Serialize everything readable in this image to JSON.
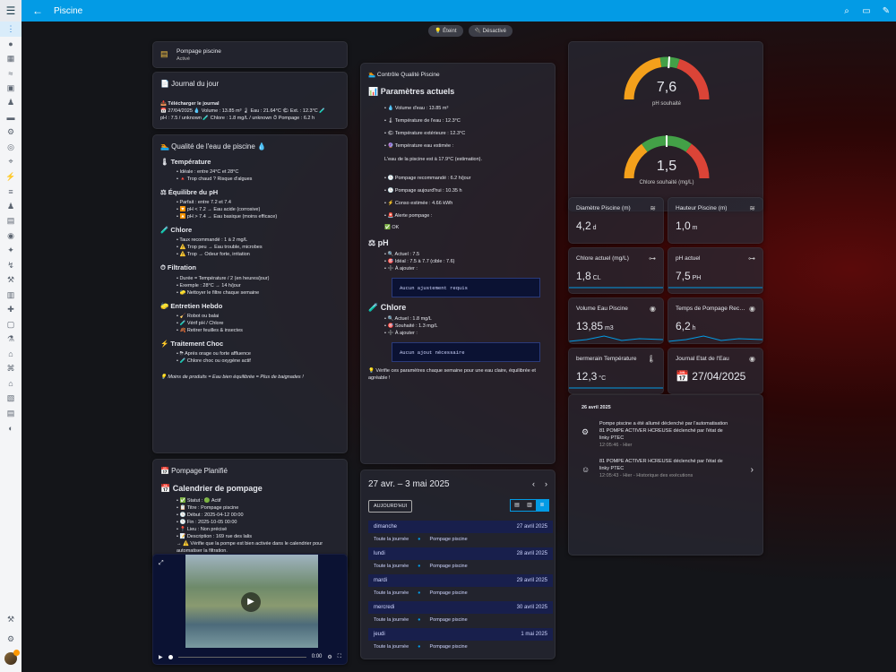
{
  "header": {
    "title": "Piscine",
    "menu_icon": "menu-icon",
    "back_icon": "arrow-left-icon",
    "actions": [
      "search-icon",
      "chat-icon",
      "pencil-icon"
    ]
  },
  "chips": [
    {
      "icon": "💡",
      "label": "Éteint"
    },
    {
      "icon": "🔌",
      "label": "Désactivé"
    }
  ],
  "pump": {
    "title": "Pompage piscine",
    "status": "Activé"
  },
  "journal": {
    "title": "📄 Journal du jour",
    "download": "📥 Télécharger le journal",
    "line1": "📅 27/04/2025 💧 Volume : 13.85 m³ 🌡 Eau : 21.64°C 🌤 Ext. : 12.3°C 🧪",
    "line2": "pH : 7.5 / unknown 🧪 Chlore : 1.8 mg/L / unknown ⏱ Pompage : 6.2 h"
  },
  "quality": {
    "title": "🏊 Qualité de l'eau de piscine 💧",
    "sections": [
      {
        "title": "🌡 Température",
        "items": [
          "• Idéale : entre 24°C et 28°C",
          "• 🔺 Trop chaud ? Risque d'algues"
        ]
      },
      {
        "title": "⚖ Équilibre du pH",
        "items": [
          "• Parfait : entre 7.2 et 7.4",
          "• 🔽 pH < 7.2 → Eau acide (corrosive)",
          "• 🔼 pH > 7.4 → Eau basique (moins efficace)"
        ]
      },
      {
        "title": "🧪 Chlore",
        "items": [
          "• Taux recommandé : 1 à 2 mg/L",
          "• ⚠️ Trop peu → Eau trouble, microbes",
          "• ⚠️ Trop → Odeur forte, irritation"
        ]
      },
      {
        "title": "⏱ Filtration",
        "items": [
          "• Durée = Température / 2 (en heures/jour)",
          "• Exemple : 28°C → 14 h/jour",
          "• 🧽 Nettoyer le filtre chaque semaine"
        ]
      },
      {
        "title": "🧽 Entretien Hebdo",
        "items": [
          "• 🧹 Robot ou balai",
          "• 🧪 Vérif pH / Chlore",
          "• 🍂 Retirer feuilles & insectes"
        ]
      },
      {
        "title": "⚡ Traitement Choc",
        "items": [
          "• ⛈ Après orage ou forte affluence",
          "• 🧪 Chlore choc ou oxygène actif"
        ]
      }
    ],
    "footer": "💡 Moins de produits = Eau bien équilibrée = Plus de baignades !"
  },
  "planned": {
    "title": "📅 Pompage Planifié",
    "heading": "📅 Calendrier de pompage",
    "items": [
      "• ✅ Statut : 🟢 Actif",
      "• 📋 Titre : Pompage piscine",
      "• 🕒 Début : 2025-04-12 00:00",
      "• 🕓 Fin : 2025-10-05 00:00",
      "• 📍 Lieu : Non précisé",
      "• 📝 Description : 169 rue des lalis"
    ],
    "note": "→ ⚠️ Vérifie que la pompe est bien activée dans le calendrier pour automatiser la filtration."
  },
  "video": {
    "time": "0:00"
  },
  "control": {
    "title": "🏊 Contrôle Qualité Piscine",
    "heading": "📊 Paramètres actuels",
    "params": [
      "• 💧 Volume d'eau : 13.85 m³",
      "• 🌡 Température de l'eau : 12.3°C",
      "• 🌤 Température extérieure : 12.3°C",
      "• 🔮 Température eau estimée :"
    ],
    "estimate": "L'eau de la piscine est à 17.9°C (estimation).",
    "params2": [
      "• 🕒 Pompage recommandé : 6.2 h/jour",
      "• 🕒 Pompage aujourd'hui : 10.35 h",
      "• ⚡ Conso estimée : 4.66 kWh",
      "• 🚨 Alerte pompage :"
    ],
    "ok": "✅ OK",
    "ph_title": "⚖ pH",
    "ph_items": [
      "• 🔍 Actuel : 7.5",
      "• 🎯 Idéal : 7.5 à 7.7 (cible : 7.6)",
      "• ➕ À ajouter :"
    ],
    "ph_code": "Aucun ajustement requis",
    "cl_title": "🧪 Chlore",
    "cl_items": [
      "• 🔍 Actuel : 1.8 mg/L",
      "• 🎯 Souhaité : 1.3 mg/L",
      "• ➕ À ajouter :"
    ],
    "cl_code": "Aucun ajout nécessaire",
    "footer": "💡 Vérifie ces paramètres chaque semaine pour une eau claire, équilibrée et agréable !"
  },
  "calendar": {
    "range": "27 avr. – 3 mai 2025",
    "today": "AUJOURD'HUI",
    "days": [
      {
        "day": "dimanche",
        "date": "27 avril 2025"
      },
      {
        "day": "lundi",
        "date": "28 avril 2025"
      },
      {
        "day": "mardi",
        "date": "29 avril 2025"
      },
      {
        "day": "mercredi",
        "date": "30 avril 2025"
      },
      {
        "day": "jeudi",
        "date": "1 mai 2025"
      }
    ],
    "event_time": "Toute la journée",
    "event_name": "Pompage piscine"
  },
  "gauges": [
    {
      "value": "7,6",
      "label": "pH souhaité",
      "level": 0.52
    },
    {
      "value": "1,5",
      "label": "Chlore souhaité (mg/L)",
      "level": 0.5
    }
  ],
  "tiles": [
    {
      "title": "Diamètre Piscine (m)",
      "value": "4,2",
      "unit": "d",
      "icon": "pool-icon"
    },
    {
      "title": "Hauteur Piscine (m)",
      "value": "1,0",
      "unit": "m",
      "icon": "pool-icon"
    },
    {
      "title": "Chlore actuel (mg/L)",
      "value": "1,8",
      "unit": "CL",
      "icon": "ruler-icon"
    },
    {
      "title": "pH actuel",
      "value": "7,5",
      "unit": "PH",
      "icon": "ruler-icon"
    },
    {
      "title": "Volume Eau Piscine",
      "value": "13,85",
      "unit": "m3",
      "icon": "eye-icon"
    },
    {
      "title": "Temps de Pompage Rec…",
      "value": "6,2",
      "unit": "h",
      "icon": "eye-icon"
    },
    {
      "title": "bermerain Température",
      "value": "12,3",
      "unit": "°C",
      "icon": "thermometer-icon"
    },
    {
      "title": "Journal Etat de l'Eau",
      "value": "📅 27/04/2025",
      "unit": "",
      "icon": "eye-icon"
    }
  ],
  "logbook": {
    "date": "26 avril 2025",
    "entries": [
      {
        "text": "Pompe piscine a été allumé déclenché par l'automatisation",
        "sub1": "81 POMPE ACTIVER HCREUSE déclenché par l'état de",
        "sub2": "linky PTEC",
        "time": "12:05:46 - Hier"
      },
      {
        "text": "81 POMPE ACTIVER HCREUSE déclenché par l'état de",
        "sub1": "linky PTEC",
        "sub2": "",
        "time": "12:05:43 - Hier - Historique des exécutions"
      }
    ]
  }
}
